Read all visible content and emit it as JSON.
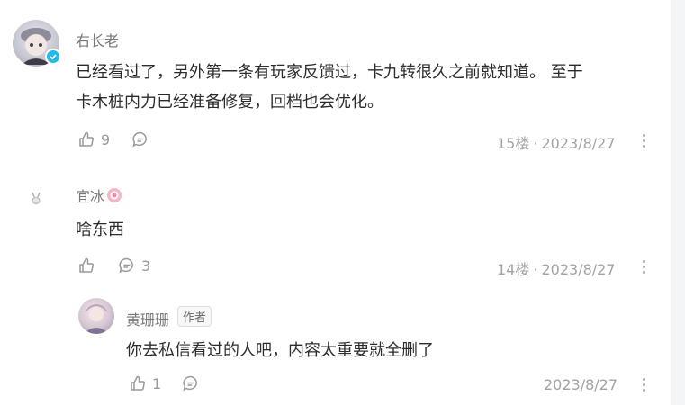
{
  "comments": [
    {
      "username": "右长老",
      "content_line1": "已经看过了，另外第一条有玩家反馈过，卡九转很久之前就知道。 至于",
      "content_line2": "卡木桩内力已经准备修复，回档也会优化。",
      "likes": "9",
      "replies": "",
      "floor": "15楼",
      "date": "2023/8/27",
      "verified": true
    },
    {
      "username": "宜冰",
      "content": "啥东西",
      "likes": "",
      "replies": "3",
      "floor": "14楼",
      "date": "2023/8/27"
    }
  ],
  "reply": {
    "username": "黄珊珊",
    "author_tag": "作者",
    "content": "你去私信看过的人吧，内容太重要就全删了",
    "likes": "1",
    "date": "2023/8/27"
  },
  "separator": "·",
  "colors": {
    "verified_badge": "#25b7e8",
    "meta_text": "#a3a3a3",
    "body_text": "#2b2b2b"
  }
}
